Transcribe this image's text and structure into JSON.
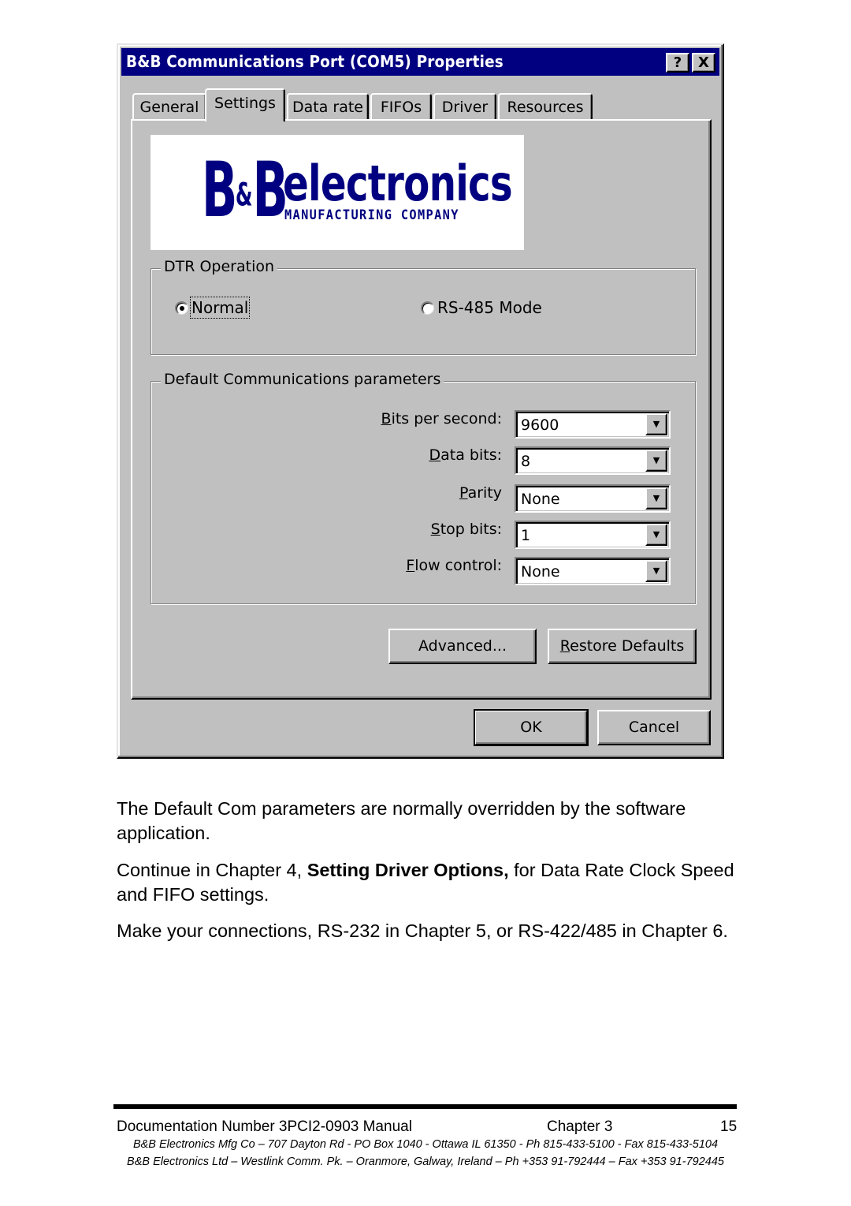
{
  "dialog": {
    "title": "B&B Communications Port (COM5) Properties",
    "help_button": "?",
    "close_button": "X",
    "tabs": [
      {
        "label": "General",
        "active": false
      },
      {
        "label": "Settings",
        "active": true
      },
      {
        "label": "Data rate",
        "active": false
      },
      {
        "label": "FIFOs",
        "active": false
      },
      {
        "label": "Driver",
        "active": false
      },
      {
        "label": "Resources",
        "active": false
      }
    ],
    "logo": {
      "letters_left": "B",
      "ampersand": "&",
      "letters_right": "B",
      "word": "electronics",
      "subtitle": "MANUFACTURING COMPANY",
      "color": "#000080"
    },
    "dtr_group": {
      "label": "DTR Operation",
      "options": [
        {
          "label": "Normal",
          "checked": true
        },
        {
          "label": "RS-485 Mode",
          "checked": false
        }
      ]
    },
    "comm_group": {
      "label": "Default Communications parameters",
      "fields": [
        {
          "label_accel": "B",
          "label_rest": "its per second:",
          "value": "9600"
        },
        {
          "label_accel": "D",
          "label_rest": "ata bits:",
          "value": "8"
        },
        {
          "label_accel": "P",
          "label_rest": "arity",
          "value": "None"
        },
        {
          "label_accel": "S",
          "label_rest": "top bits:",
          "value": "1"
        },
        {
          "label_accel": "F",
          "label_rest": "low control:",
          "value": "None"
        }
      ]
    },
    "advanced_button": "Advanced...",
    "restore_button_accel": "R",
    "restore_button_rest": "estore Defaults",
    "ok_button": "OK",
    "cancel_button": "Cancel",
    "colors": {
      "titlebar": "#000080",
      "face": "#c0c0c0"
    }
  },
  "body": {
    "para1": "The Default Com parameters are normally overridden by the software application.",
    "para2_pre": "Continue in Chapter 4, ",
    "para2_bold": "Setting Driver Options,",
    "para2_post": " for Data Rate Clock Speed and FIFO settings.",
    "para3": "Make your connections, RS-232 in Chapter 5, or RS-422/485 in Chapter 6."
  },
  "footer": {
    "doc_number": "Documentation Number 3PCI2-0903 Manual",
    "chapter": "Chapter 3",
    "page": "15",
    "address_us": "B&B Electronics Mfg Co – 707 Dayton Rd - PO Box 1040 - Ottawa IL 61350 - Ph 815-433-5100 - Fax 815-433-5104",
    "address_ie": "B&B Electronics Ltd – Westlink Comm. Pk. – Oranmore, Galway, Ireland – Ph +353 91-792444 – Fax +353 91-792445"
  }
}
